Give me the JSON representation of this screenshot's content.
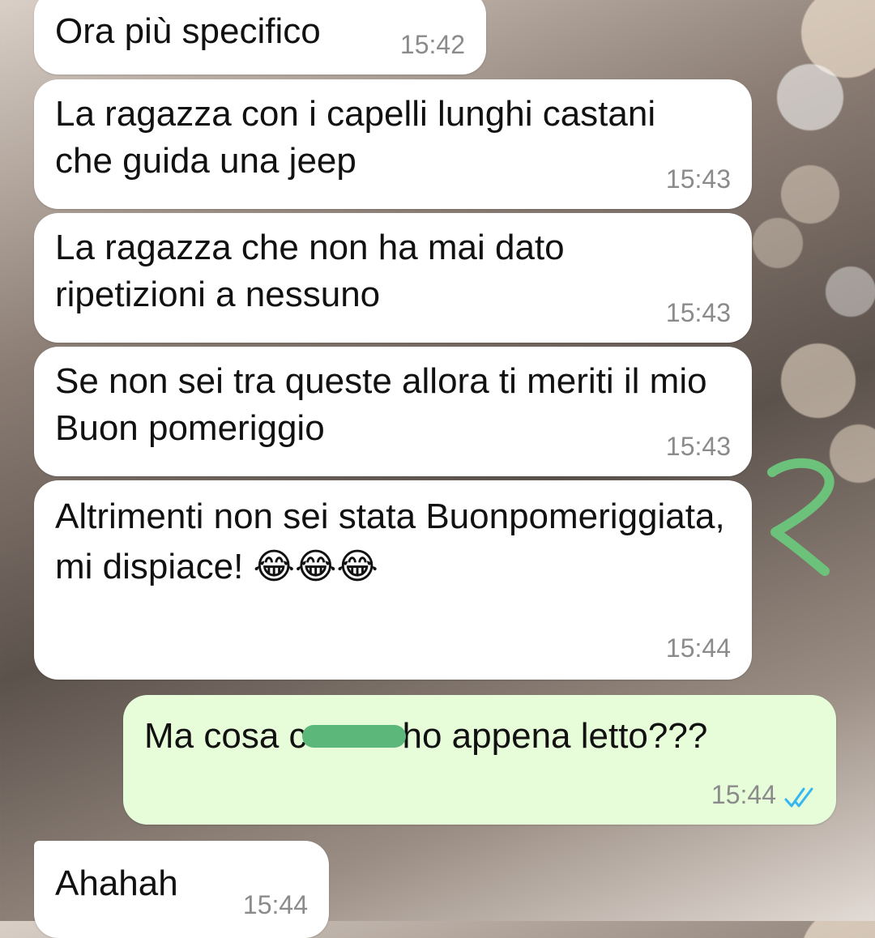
{
  "messages": [
    {
      "dir": "in",
      "text": "Ora più specifico",
      "time": "15:42"
    },
    {
      "dir": "in",
      "text": "La ragazza con i capelli lunghi castani che guida una jeep",
      "time": "15:43"
    },
    {
      "dir": "in",
      "text": "La ragazza che non ha mai dato ripetizioni a nessuno",
      "time": "15:43"
    },
    {
      "dir": "in",
      "text": "Se non sei tra queste allora ti meriti il mio Buon pomeriggio",
      "time": "15:43"
    },
    {
      "dir": "in",
      "text": "Altrimenti non sei stata Buonpomeriggiata, mi dispiace!",
      "emoji": "😂😂😂",
      "time": "15:44"
    },
    {
      "dir": "out",
      "text_before": "Ma cosa c",
      "text_after": "ho appena letto???",
      "time": "15:44",
      "status": "read"
    },
    {
      "dir": "in",
      "text": "Ahahah",
      "time": "15:44"
    }
  ],
  "colors": {
    "incoming_bubble": "#ffffff",
    "outgoing_bubble": "#e7fcd9",
    "read_ticks": "#34b7f1",
    "censor_mark": "#5cb87a",
    "annotation_mark": "#6cc27a"
  },
  "icons": {
    "read_status": "double-check-icon",
    "annotation": "hand-drawn-2-mark"
  }
}
